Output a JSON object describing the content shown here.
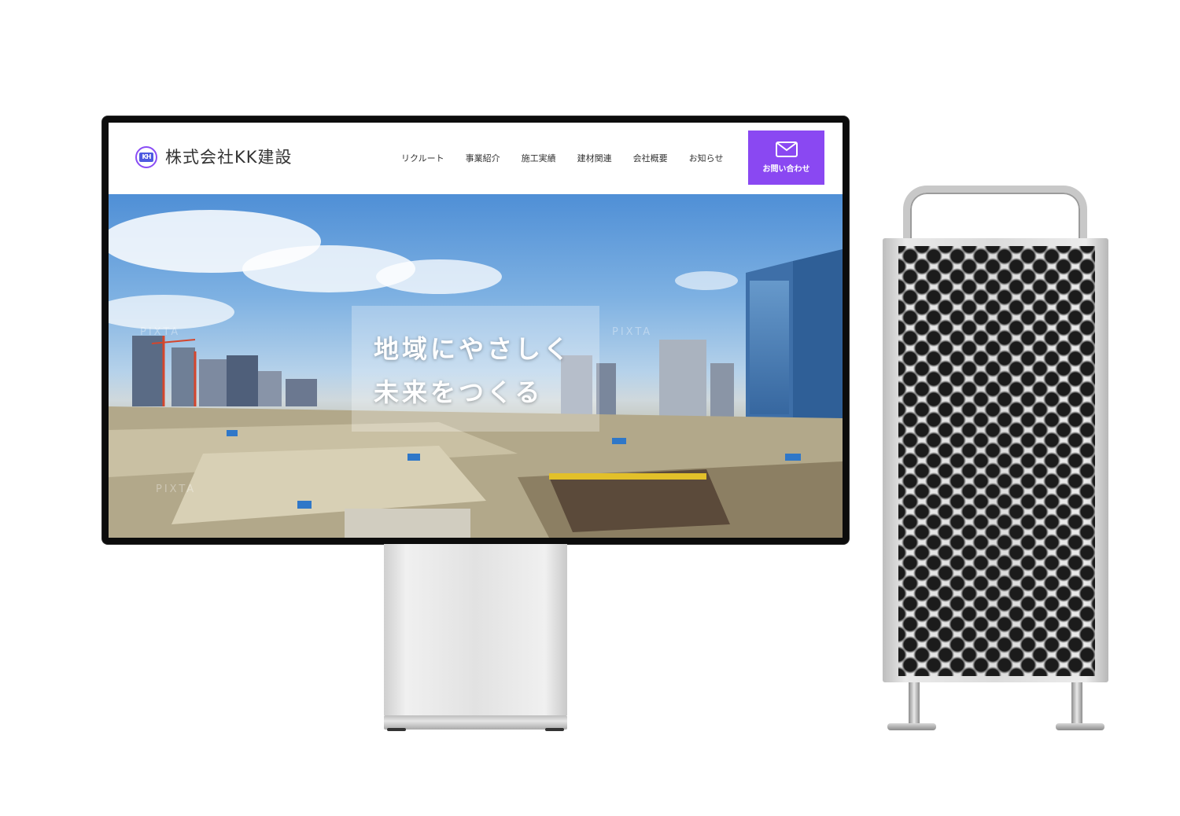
{
  "site": {
    "company_name": "株式会社KK建設",
    "logo_mark_text": "KH",
    "nav": [
      "リクルート",
      "事業紹介",
      "施工実績",
      "建材関連",
      "会社概要",
      "お知らせ"
    ],
    "contact_label": "お問い合わせ",
    "hero_line_1": "地域にやさしく",
    "hero_line_2": "未来をつくる",
    "watermark": "PIXTA"
  },
  "colors": {
    "accent": "#8a48f2",
    "monitor_frame": "#0c0c0c"
  }
}
